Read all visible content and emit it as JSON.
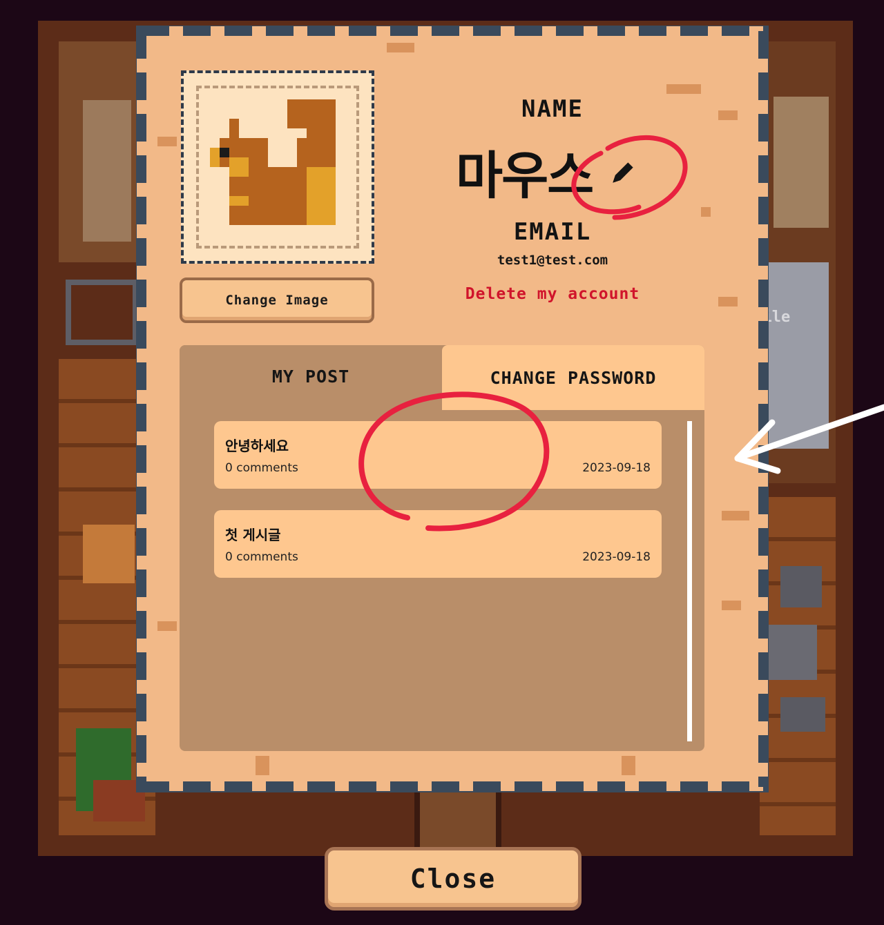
{
  "profile": {
    "name_label": "NAME",
    "name_value": "마우스",
    "email_label": "EMAIL",
    "email_value": "test1@test.com",
    "change_image_label": "Change Image",
    "delete_account_label": "Delete my account"
  },
  "tabs": [
    {
      "label": "MY POST",
      "active": true
    },
    {
      "label": "CHANGE PASSWORD",
      "active": false
    }
  ],
  "posts": [
    {
      "title": "안녕하세요",
      "comments": "0 comments",
      "date": "2023-09-18"
    },
    {
      "title": "첫 게시글",
      "comments": "0 comments",
      "date": "2023-09-18"
    }
  ],
  "close_label": "Close",
  "background_sign": "ofile",
  "icons": {
    "avatar": "squirrel-icon",
    "edit": "pencil-icon"
  },
  "colors": {
    "parchment": "#f2b988",
    "tab_panel": "#b98e69",
    "card": "#fec78f",
    "delete_red": "#d0142b",
    "annotation_red": "#e8213f"
  }
}
